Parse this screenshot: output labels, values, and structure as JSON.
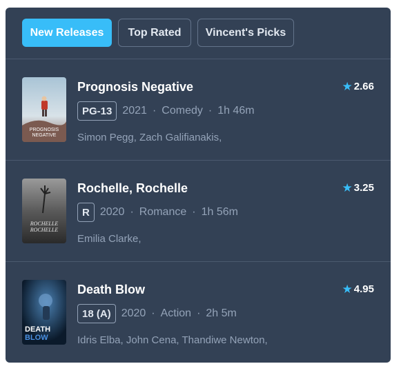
{
  "tabs": [
    {
      "label": "New Releases",
      "active": true
    },
    {
      "label": "Top Rated",
      "active": false
    },
    {
      "label": "Vincent's Picks",
      "active": false
    }
  ],
  "movies": [
    {
      "title": "Prognosis Negative",
      "rating": "2.66",
      "certification": "PG-13",
      "year": "2021",
      "genre": "Comedy",
      "runtime": "1h 46m",
      "cast": "Simon Pegg, Zach Galifianakis,",
      "poster_text": [
        "PROGNOSIS",
        "NEGATIVE"
      ]
    },
    {
      "title": "Rochelle, Rochelle",
      "rating": "3.25",
      "certification": "R",
      "year": "2020",
      "genre": "Romance",
      "runtime": "1h 56m",
      "cast": "Emilia Clarke,",
      "poster_text": [
        "ROCHELLE",
        "ROCHELLE"
      ]
    },
    {
      "title": "Death Blow",
      "rating": "4.95",
      "certification": "18 (A)",
      "year": "2020",
      "genre": "Action",
      "runtime": "2h 5m",
      "cast": "Idris Elba, John Cena, Thandiwe Newton,",
      "poster_text": [
        "DEATH",
        "BLOW"
      ]
    }
  ],
  "icons": {
    "rating": "star-icon"
  },
  "colors": {
    "panel": "#334155",
    "accent": "#38bdf8",
    "muted": "#94a3b8"
  }
}
